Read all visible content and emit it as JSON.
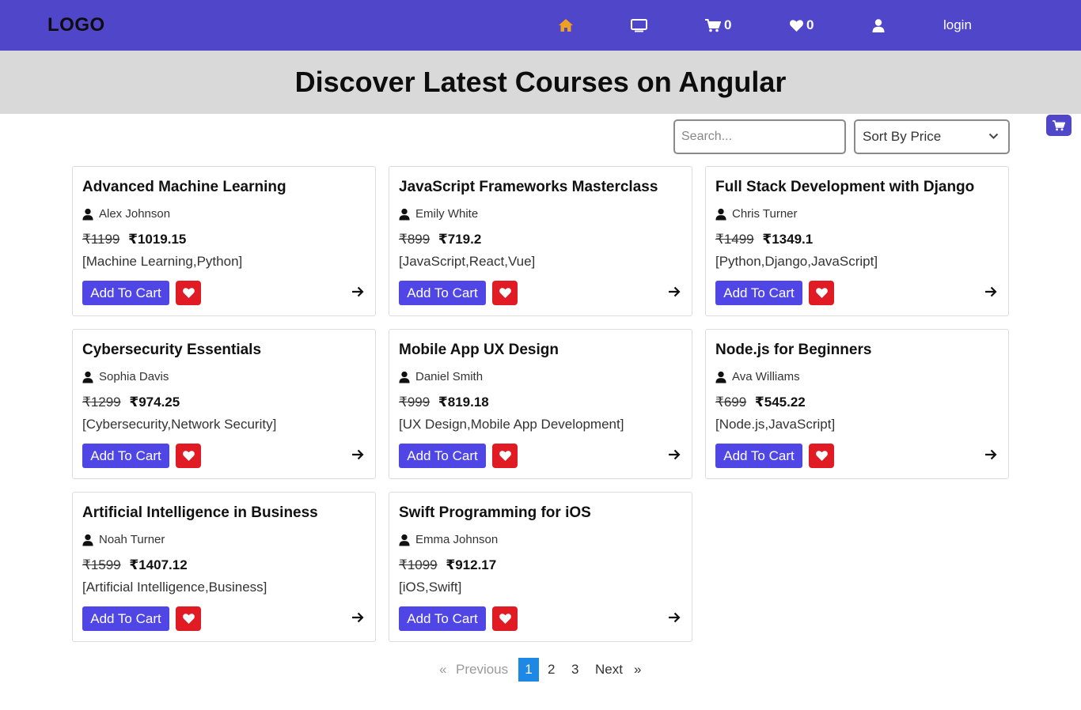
{
  "navbar": {
    "logo": "LOGO",
    "cart_count": "0",
    "wishlist_count": "0",
    "login_label": "login",
    "bg_color": "#4f46c9",
    "icons": [
      "home-icon",
      "monitor-icon",
      "cart-icon",
      "heart-icon",
      "user-icon"
    ]
  },
  "hero": {
    "title": "Discover Latest Courses on Angular"
  },
  "controls": {
    "search_placeholder": "Search...",
    "sort_label": "Sort By Price"
  },
  "courses": [
    {
      "title": "Advanced Machine Learning",
      "author": "Alex Johnson",
      "old_price": "₹1199",
      "new_price": "₹1019.15",
      "tags": "[Machine Learning,Python]",
      "button": "Add To Cart"
    },
    {
      "title": "JavaScript Frameworks Masterclass",
      "author": "Emily White",
      "old_price": "₹899",
      "new_price": "₹719.2",
      "tags": "[JavaScript,React,Vue]",
      "button": "Add To Cart"
    },
    {
      "title": "Full Stack Development with Django",
      "author": "Chris Turner",
      "old_price": "₹1499",
      "new_price": "₹1349.1",
      "tags": "[Python,Django,JavaScript]",
      "button": "Add To Cart"
    },
    {
      "title": "Cybersecurity Essentials",
      "author": "Sophia Davis",
      "old_price": "₹1299",
      "new_price": "₹974.25",
      "tags": "[Cybersecurity,Network Security]",
      "button": "Add To Cart"
    },
    {
      "title": "Mobile App UX Design",
      "author": "Daniel Smith",
      "old_price": "₹999",
      "new_price": "₹819.18",
      "tags": "[UX Design,Mobile App Development]",
      "button": "Add To Cart"
    },
    {
      "title": "Node.js for Beginners",
      "author": "Ava Williams",
      "old_price": "₹699",
      "new_price": "₹545.22",
      "tags": "[Node.js,JavaScript]",
      "button": "Add To Cart"
    },
    {
      "title": "Artificial Intelligence in Business",
      "author": "Noah Turner",
      "old_price": "₹1599",
      "new_price": "₹1407.12",
      "tags": "[Artificial Intelligence,Business]",
      "button": "Add To Cart"
    },
    {
      "title": "Swift Programming for iOS",
      "author": "Emma Johnson",
      "old_price": "₹1099",
      "new_price": "₹912.17",
      "tags": "[iOS,Swift]",
      "button": "Add To Cart"
    }
  ],
  "pagination": {
    "prev_symbol": "«",
    "prev_label": "Previous",
    "pages": [
      "1",
      "2",
      "3"
    ],
    "active_page": "1",
    "next_label": "Next",
    "next_symbol": "»"
  },
  "colors": {
    "accent": "#4f46e5",
    "favorite": "#e01b24",
    "active_page": "#1e88e5",
    "hero_bg": "#d9d9d9"
  }
}
